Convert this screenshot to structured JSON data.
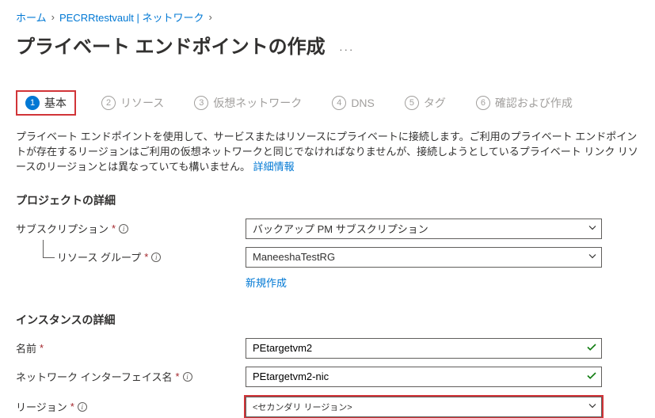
{
  "breadcrumb": {
    "home": "ホーム",
    "vault": "PECRRtestvault | ネットワーク"
  },
  "page_title": "プライベート エンドポイントの作成",
  "tabs": [
    {
      "num": "1",
      "label": "基本"
    },
    {
      "num": "2",
      "label": "リソース"
    },
    {
      "num": "3",
      "label": "仮想ネットワーク"
    },
    {
      "num": "4",
      "label": "DNS"
    },
    {
      "num": "5",
      "label": "タグ"
    },
    {
      "num": "6",
      "label": "確認および作成"
    }
  ],
  "description": "プライベート エンドポイントを使用して、サービスまたはリソースにプライベートに接続します。ご利用のプライベート エンドポイントが存在するリージョンはご利用の仮想ネットワークと同じでなければなりませんが、接続しようとしているプライベート リンク リソースのリージョンとは異なっていても構いません。",
  "description_link": "詳細情報",
  "sections": {
    "project": "プロジェクトの詳細",
    "instance": "インスタンスの詳細"
  },
  "fields": {
    "subscription": {
      "label": "サブスクリプション",
      "value": "バックアップ PM サブスクリプション"
    },
    "resource_group": {
      "label": "リソース グループ",
      "value": "ManeeshaTestRG",
      "new_link": "新規作成"
    },
    "name": {
      "label": "名前",
      "value": "PEtargetvm2"
    },
    "nic_name": {
      "label": "ネットワーク インターフェイス名",
      "value": "PEtargetvm2-nic"
    },
    "region": {
      "label": "リージョン",
      "value": "<セカンダリ リージョン>"
    }
  }
}
